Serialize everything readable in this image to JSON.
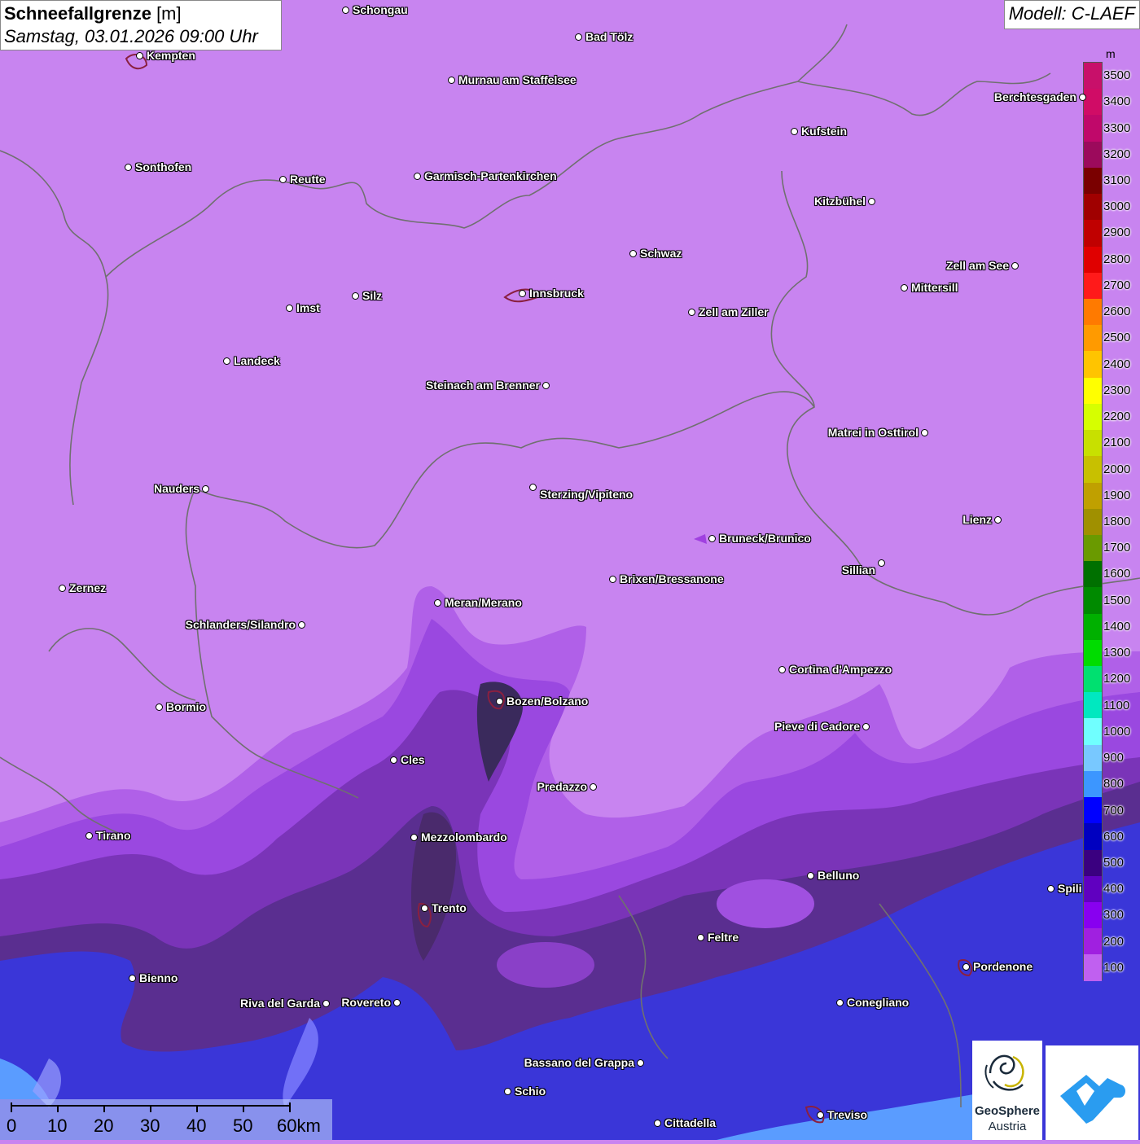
{
  "header": {
    "title_bold": "Schneefallgrenze",
    "title_unit": " [m]",
    "datetime": "Samstag, 03.01.2026 09:00 Uhr",
    "model": "Modell: C-LAEF"
  },
  "legend": {
    "unit": "m",
    "levels": [
      {
        "value": "3500",
        "color": "#c8106a"
      },
      {
        "value": "3400",
        "color": "#d00c66"
      },
      {
        "value": "3300",
        "color": "#c0086a"
      },
      {
        "value": "3200",
        "color": "#9c0a5c"
      },
      {
        "value": "3100",
        "color": "#7a0000"
      },
      {
        "value": "3000",
        "color": "#a00000"
      },
      {
        "value": "2900",
        "color": "#c00000"
      },
      {
        "value": "2800",
        "color": "#e00000"
      },
      {
        "value": "2700",
        "color": "#ff1a1a"
      },
      {
        "value": "2600",
        "color": "#ff7a00"
      },
      {
        "value": "2500",
        "color": "#ff9a00"
      },
      {
        "value": "2400",
        "color": "#ffc400"
      },
      {
        "value": "2300",
        "color": "#ffff00"
      },
      {
        "value": "2200",
        "color": "#d6ff00"
      },
      {
        "value": "2100",
        "color": "#c8e000"
      },
      {
        "value": "2000",
        "color": "#c8c000"
      },
      {
        "value": "1900",
        "color": "#c0a000"
      },
      {
        "value": "1800",
        "color": "#a09000"
      },
      {
        "value": "1700",
        "color": "#6a9a00"
      },
      {
        "value": "1600",
        "color": "#007000"
      },
      {
        "value": "1500",
        "color": "#008a00"
      },
      {
        "value": "1400",
        "color": "#00b000"
      },
      {
        "value": "1300",
        "color": "#00dc00"
      },
      {
        "value": "1200",
        "color": "#00e070"
      },
      {
        "value": "1100",
        "color": "#00e8c0"
      },
      {
        "value": "1000",
        "color": "#70ffff"
      },
      {
        "value": "900",
        "color": "#78c8ff"
      },
      {
        "value": "800",
        "color": "#3c96ff"
      },
      {
        "value": "700",
        "color": "#0000ff"
      },
      {
        "value": "600",
        "color": "#0000c0"
      },
      {
        "value": "500",
        "color": "#3a0080"
      },
      {
        "value": "400",
        "color": "#6000c0"
      },
      {
        "value": "300",
        "color": "#8800f0"
      },
      {
        "value": "200",
        "color": "#a020e0"
      },
      {
        "value": "100",
        "color": "#c060f0"
      }
    ]
  },
  "cities": [
    {
      "name": "Schongau"
    },
    {
      "name": "Bad Tölz"
    },
    {
      "name": "Kempten"
    },
    {
      "name": "Murnau am Staffelsee"
    },
    {
      "name": "Berchtesgaden"
    },
    {
      "name": "Kufstein"
    },
    {
      "name": "Sonthofen"
    },
    {
      "name": "Reutte"
    },
    {
      "name": "Garmisch-Partenkirchen"
    },
    {
      "name": "Kitzbühel"
    },
    {
      "name": "Schwaz"
    },
    {
      "name": "Zell am See"
    },
    {
      "name": "Mittersill"
    },
    {
      "name": "Innsbruck"
    },
    {
      "name": "Silz"
    },
    {
      "name": "Imst"
    },
    {
      "name": "Zell am Ziller"
    },
    {
      "name": "Landeck"
    },
    {
      "name": "Steinach am Brenner"
    },
    {
      "name": "Matrei in Osttirol"
    },
    {
      "name": "Nauders"
    },
    {
      "name": "Sterzing/Vipiteno"
    },
    {
      "name": "Lienz"
    },
    {
      "name": "Bruneck/Brunico"
    },
    {
      "name": "Sillian"
    },
    {
      "name": "Zernez"
    },
    {
      "name": "Brixen/Bressanone"
    },
    {
      "name": "Meran/Merano"
    },
    {
      "name": "Schlanders/Silandro"
    },
    {
      "name": "Cortina d'Ampezzo"
    },
    {
      "name": "Bozen/Bolzano"
    },
    {
      "name": "Bormio"
    },
    {
      "name": "Pieve di Cadore"
    },
    {
      "name": "Cles"
    },
    {
      "name": "Predazzo"
    },
    {
      "name": "Tirano"
    },
    {
      "name": "Mezzolombardo"
    },
    {
      "name": "Belluno"
    },
    {
      "name": "Spili"
    },
    {
      "name": "Trento"
    },
    {
      "name": "Feltre"
    },
    {
      "name": "Pordenone"
    },
    {
      "name": "Bienno"
    },
    {
      "name": "Riva del Garda"
    },
    {
      "name": "Rovereto"
    },
    {
      "name": "Conegliano"
    },
    {
      "name": "Bassano del Grappa"
    },
    {
      "name": "Schio"
    },
    {
      "name": "Treviso"
    },
    {
      "name": "Cittadella"
    }
  ],
  "scale_bar": {
    "labels": [
      "0",
      "10",
      "20",
      "30",
      "40",
      "50",
      "60km"
    ]
  },
  "logos": {
    "geosphere_line1": "GeoSphere",
    "geosphere_line2": "Austria"
  },
  "colors": {
    "base_purple": "#c884f0",
    "band_200": "#a656dc",
    "band_300": "#8a3cd2",
    "band_400": "#6a30a8",
    "band_500": "#4a2a7c",
    "band_blue": "#3a3ae8",
    "band_lightblue": "#5a90ff"
  }
}
